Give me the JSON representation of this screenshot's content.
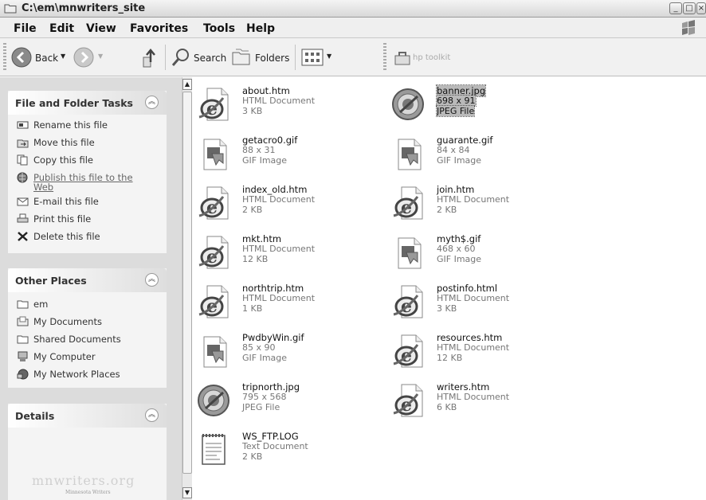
{
  "window": {
    "title": "C:\\em\\mnwriters_site"
  },
  "menu": [
    "File",
    "Edit",
    "View",
    "Favorites",
    "Tools",
    "Help"
  ],
  "toolbar": {
    "back_label": "Back",
    "search_label": "Search",
    "folders_label": "Folders",
    "hp_label": "hp toolkit"
  },
  "file_tasks": {
    "title": "File and Folder Tasks",
    "items": [
      {
        "label": "Rename this file",
        "icon": "rename-icon"
      },
      {
        "label": "Move this file",
        "icon": "move-icon"
      },
      {
        "label": "Copy this file",
        "icon": "copy-icon"
      },
      {
        "label": "Publish this file to the",
        "label2": "Web",
        "icon": "globe-icon"
      },
      {
        "label": "E-mail this file",
        "icon": "email-icon"
      },
      {
        "label": "Print this file",
        "icon": "print-icon"
      },
      {
        "label": "Delete this file",
        "icon": "delete-icon"
      }
    ]
  },
  "other_places": {
    "title": "Other Places",
    "items": [
      {
        "label": "em",
        "icon": "folder-icon"
      },
      {
        "label": "My Documents",
        "icon": "my-documents-icon"
      },
      {
        "label": "Shared Documents",
        "icon": "folder-icon"
      },
      {
        "label": "My Computer",
        "icon": "computer-icon"
      },
      {
        "label": "My Network Places",
        "icon": "network-icon"
      }
    ]
  },
  "details": {
    "title": "Details",
    "watermark": "mnwriters.org",
    "watermark_sub": "Minnesota Writers"
  },
  "files": [
    {
      "name": "about.htm",
      "l1": "HTML Document",
      "l2": "3 KB",
      "icon": "ie-document-icon"
    },
    {
      "name": "banner.jpg",
      "l1": "698 x 91",
      "l2": "JPEG File",
      "icon": "image-viewer-icon",
      "selected": true
    },
    {
      "name": "getacro0.gif",
      "l1": "88 x 31",
      "l2": "GIF Image",
      "icon": "gif-image-icon"
    },
    {
      "name": "guarante.gif",
      "l1": "84 x 84",
      "l2": "GIF Image",
      "icon": "gif-image-icon"
    },
    {
      "name": "index_old.htm",
      "l1": "HTML Document",
      "l2": "2 KB",
      "icon": "ie-document-icon"
    },
    {
      "name": "join.htm",
      "l1": "HTML Document",
      "l2": "2 KB",
      "icon": "ie-document-icon"
    },
    {
      "name": "mkt.htm",
      "l1": "HTML Document",
      "l2": "12 KB",
      "icon": "ie-document-icon"
    },
    {
      "name": "myth$.gif",
      "l1": "468 x 60",
      "l2": "GIF Image",
      "icon": "gif-image-icon"
    },
    {
      "name": "northtrip.htm",
      "l1": "HTML Document",
      "l2": "1 KB",
      "icon": "ie-document-icon"
    },
    {
      "name": "postinfo.html",
      "l1": "HTML Document",
      "l2": "3 KB",
      "icon": "ie-document-icon"
    },
    {
      "name": "PwdbyWin.gif",
      "l1": "85 x 90",
      "l2": "GIF Image",
      "icon": "gif-image-icon"
    },
    {
      "name": "resources.htm",
      "l1": "HTML Document",
      "l2": "12 KB",
      "icon": "ie-document-icon"
    },
    {
      "name": "tripnorth.jpg",
      "l1": "795 x 568",
      "l2": "JPEG File",
      "icon": "image-viewer-icon"
    },
    {
      "name": "writers.htm",
      "l1": "HTML Document",
      "l2": "6 KB",
      "icon": "ie-document-icon"
    },
    {
      "name": "WS_FTP.LOG",
      "l1": "Text Document",
      "l2": "2 KB",
      "icon": "text-document-icon"
    }
  ]
}
